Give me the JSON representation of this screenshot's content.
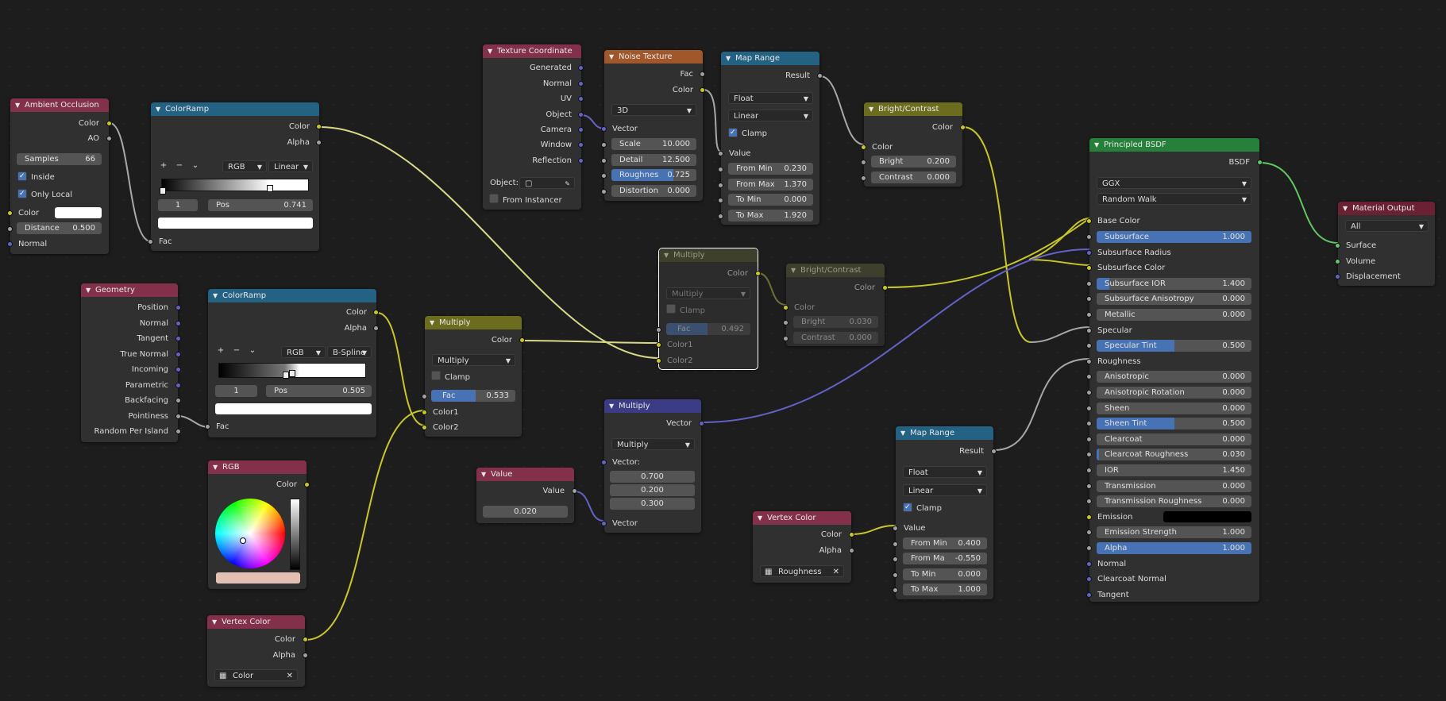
{
  "colors": {
    "background": "#1d1d1d",
    "node_bg": "#303030",
    "input_header": "#83314a",
    "converter_header": "#246283",
    "color_header": "#6c6c1e",
    "vector_header": "#3b3b86",
    "texture_header": "#a0582a",
    "shader_header": "#27803a",
    "output_header": "#6a2134",
    "socket_color": "#c7c729",
    "socket_float": "#a1a1a1",
    "socket_vector": "#6363c7",
    "socket_shader": "#63c763",
    "slider_fill": "#4772b3"
  },
  "ao": {
    "title": "Ambient Occlusion",
    "out_color": "Color",
    "out_ao": "AO",
    "samples_label": "Samples",
    "samples": "66",
    "inside": "Inside",
    "only_local": "Only Local",
    "in_color": "Color",
    "distance_label": "Distance",
    "distance": "0.500",
    "in_normal": "Normal"
  },
  "ramp1": {
    "title": "ColorRamp",
    "out_color": "Color",
    "out_alpha": "Alpha",
    "add": "+",
    "remove": "−",
    "menu": "⌄",
    "mode": "RGB",
    "interp": "Linear",
    "index": "1",
    "pos_label": "Pos",
    "pos": "0.741",
    "in_fac": "Fac"
  },
  "texcoord": {
    "title": "Texture Coordinate",
    "outs": [
      "Generated",
      "Normal",
      "UV",
      "Object",
      "Camera",
      "Window",
      "Reflection"
    ],
    "object_label": "Object:",
    "from_instancer": "From Instancer"
  },
  "noise": {
    "title": "Noise Texture",
    "out_fac": "Fac",
    "out_color": "Color",
    "dim": "3D",
    "in_vector": "Vector",
    "scale_label": "Scale",
    "scale": "10.000",
    "detail_label": "Detail",
    "detail": "12.500",
    "rough_label": "Roughness",
    "rough_short": "Roughnes",
    "rough": "0.725",
    "dist_label": "Distortion",
    "dist": "0.000",
    "rough_fraction": 0.725
  },
  "maprange1": {
    "title": "Map Range",
    "out_result": "Result",
    "type": "Float",
    "interp": "Linear",
    "clamp": "Clamp",
    "in_value": "Value",
    "from_min_label": "From Min",
    "from_min": "0.230",
    "from_max_label": "From Max",
    "from_max": "1.370",
    "to_min_label": "To Min",
    "to_min": "0.000",
    "to_max_label": "To Max",
    "to_max": "1.920"
  },
  "bc1": {
    "title": "Bright/Contrast",
    "out_color": "Color",
    "in_color": "Color",
    "bright_label": "Bright",
    "bright": "0.200",
    "contrast_label": "Contrast",
    "contrast": "0.000"
  },
  "bsdf": {
    "title": "Principled BSDF",
    "out_bsdf": "BSDF",
    "distribution": "GGX",
    "subsurface_method": "Random Walk",
    "base_color": "Base Color",
    "fields": [
      {
        "label": "Subsurface",
        "value": "1.000",
        "fill": 1.0
      },
      {
        "label": "Subsurface Radius",
        "value": "",
        "socket_only": true,
        "kind": "v"
      },
      {
        "label": "Subsurface Color",
        "value": "",
        "socket_only": true,
        "kind": "c"
      },
      {
        "label": "Subsurface IOR",
        "value": "1.400",
        "fill": 0.08
      },
      {
        "label": "Subsurface Anisotropy",
        "value": "0.000",
        "fill": 0
      },
      {
        "label": "Metallic",
        "value": "0.000",
        "fill": 0
      },
      {
        "label": "Specular",
        "value": "",
        "socket_only": true,
        "kind": "f"
      },
      {
        "label": "Specular Tint",
        "value": "0.500",
        "fill": 0.5
      },
      {
        "label": "Roughness",
        "value": "",
        "socket_only": true,
        "kind": "f"
      },
      {
        "label": "Anisotropic",
        "value": "0.000",
        "fill": 0
      },
      {
        "label": "Anisotropic Rotation",
        "value": "0.000",
        "fill": 0
      },
      {
        "label": "Sheen",
        "value": "0.000",
        "fill": 0
      },
      {
        "label": "Sheen Tint",
        "value": "0.500",
        "fill": 0.5
      },
      {
        "label": "Clearcoat",
        "value": "0.000",
        "fill": 0
      },
      {
        "label": "Clearcoat Roughness",
        "value": "0.030",
        "fill": 0.03
      },
      {
        "label": "IOR",
        "value": "1.450",
        "fill": 0
      },
      {
        "label": "Transmission",
        "value": "0.000",
        "fill": 0
      },
      {
        "label": "Transmission Roughness",
        "value": "0.000",
        "fill": 0
      },
      {
        "label": "Emission",
        "value": "",
        "swatch": "#000000",
        "kind": "c"
      },
      {
        "label": "Emission Strength",
        "value": "1.000",
        "fill": 0
      },
      {
        "label": "Alpha",
        "value": "1.000",
        "fill": 1.0
      },
      {
        "label": "Normal",
        "value": "",
        "socket_only": true,
        "kind": "v"
      },
      {
        "label": "Clearcoat Normal",
        "value": "",
        "socket_only": true,
        "kind": "v"
      },
      {
        "label": "Tangent",
        "value": "",
        "socket_only": true,
        "kind": "v"
      }
    ]
  },
  "matout": {
    "title": "Material Output",
    "target": "All",
    "in_surface": "Surface",
    "in_volume": "Volume",
    "in_displacement": "Displacement"
  },
  "geometry": {
    "title": "Geometry",
    "outs": [
      "Position",
      "Normal",
      "Tangent",
      "True Normal",
      "Incoming",
      "Parametric",
      "Backfacing",
      "Pointiness",
      "Random Per Island"
    ]
  },
  "ramp2": {
    "title": "ColorRamp",
    "out_color": "Color",
    "out_alpha": "Alpha",
    "add": "+",
    "remove": "−",
    "menu": "⌄",
    "mode": "RGB",
    "interp": "B-Spline",
    "index": "1",
    "pos_label": "Pos",
    "pos": "0.505",
    "in_fac": "Fac"
  },
  "mix1": {
    "title": "Multiply",
    "out_color": "Color",
    "blend": "Multiply",
    "clamp": "Clamp",
    "fac_label": "Fac",
    "fac": "0.533",
    "fac_fraction": 0.533,
    "in_color1": "Color1",
    "in_color2": "Color2"
  },
  "mix_muted": {
    "title": "Multiply",
    "out_color": "Color",
    "blend": "Multiply",
    "clamp": "Clamp",
    "fac_label": "Fac",
    "fac": "0.492",
    "fac_fraction": 0.492,
    "in_color1": "Color1",
    "in_color2": "Color2"
  },
  "bc2": {
    "title": "Bright/Contrast",
    "out_color": "Color",
    "in_color": "Color",
    "bright_label": "Bright",
    "bright": "0.030",
    "contrast_label": "Contrast",
    "contrast": "0.000"
  },
  "vecmath": {
    "title": "Multiply",
    "out_vector": "Vector",
    "op": "Multiply",
    "vector_label": "Vector:",
    "x": "0.700",
    "y": "0.200",
    "z": "0.300",
    "in_vector": "Vector"
  },
  "value": {
    "title": "Value",
    "out_value": "Value",
    "value": "0.020"
  },
  "rgb": {
    "title": "RGB",
    "out_color": "Color",
    "swatch": "#e3c0b1"
  },
  "vcol1": {
    "title": "Vertex Color",
    "out_color": "Color",
    "out_alpha": "Alpha",
    "layer": "Color",
    "clear": "✕"
  },
  "vcol2": {
    "title": "Vertex Color",
    "out_color": "Color",
    "out_alpha": "Alpha",
    "layer": "Roughness",
    "clear": "✕"
  },
  "maprange2": {
    "title": "Map Range",
    "out_result": "Result",
    "type": "Float",
    "interp": "Linear",
    "clamp": "Clamp",
    "in_value": "Value",
    "from_min_label": "From Min",
    "from_min": "0.400",
    "from_max_label": "From Ma",
    "from_max": "-0.550",
    "to_min_label": "To Min",
    "to_min": "0.000",
    "to_max_label": "To Max",
    "to_max": "1.000"
  }
}
